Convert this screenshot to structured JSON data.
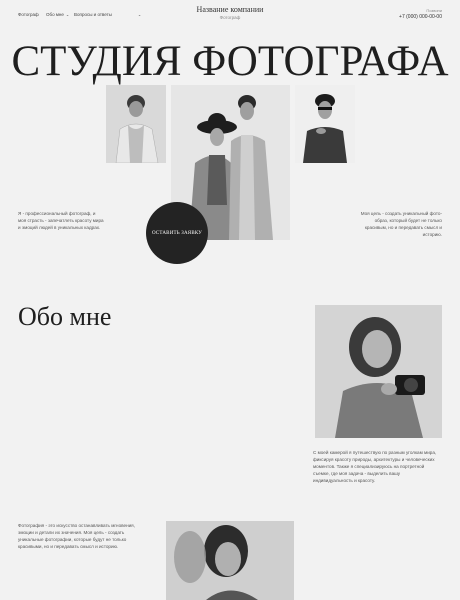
{
  "header": {
    "nav": [
      {
        "label": "Фотограф",
        "has_dropdown": false
      },
      {
        "label": "Обо мне",
        "has_dropdown": true
      },
      {
        "label": "Вопросы и ответы",
        "has_dropdown": true
      }
    ],
    "company_name": "Название компании",
    "company_subtitle": "Фотограф",
    "contact_label": "Позвони",
    "phone": "+7 (000) 000-00-00"
  },
  "hero": {
    "title": "СТУДИЯ ФОТОГРАФА",
    "left_text": "Я - профессиональный фотограф, и моя страсть - запечатлеть красоту мира и эмоций людей в уникальных кадрах.",
    "right_text": "Моя цель - создать уникальный фото-образ, который будет не только красивым, но и передавать смысл и историю.",
    "cta_label": "ОСТАВИТЬ ЗАЯВКУ"
  },
  "about": {
    "title": "Обо мне",
    "right_text": "С моей камерой я путешествую по разным уголкам мира, фиксируя красоту природы, архитектуры и человеческих моментов. Также я специализируюсь на портретной съемке, где моя задача - выделить вашу индивидуальность и красоту.",
    "left_text": "Фотография - это искусство останавливать мгновения, эмоции и детали их значения. Моя цель - создать уникальные фотографии, которые будут не только красивыми, но и передавать смысл и историю."
  },
  "colors": {
    "background": "#f2f2f2",
    "text": "#222222",
    "cta_bg": "#232323",
    "cta_text": "#ffffff"
  }
}
